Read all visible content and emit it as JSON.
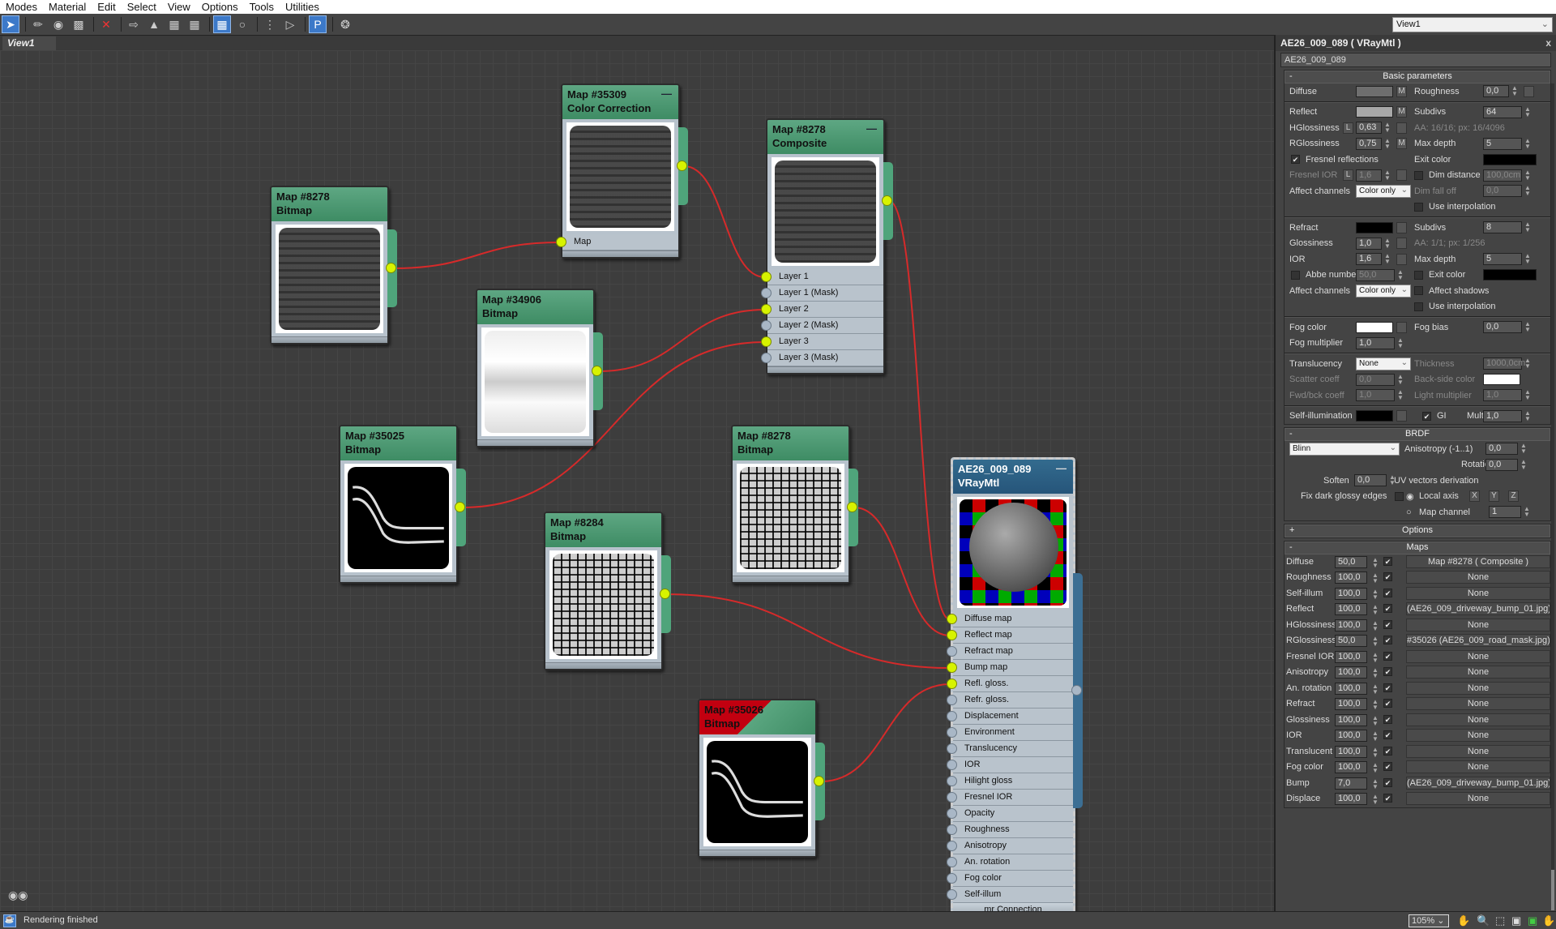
{
  "menu": [
    "Modes",
    "Material",
    "Edit",
    "Select",
    "View",
    "Options",
    "Tools",
    "Utilities"
  ],
  "toolbar": {
    "icons": [
      "select-arrow-icon",
      "eyedropper-icon",
      "put-material-icon",
      "assign-material-icon",
      "delete-icon",
      "move-children-icon",
      "layout-icon",
      "show-map-in-viewport-icon",
      "show-background-icon",
      "background-checker-icon",
      "show-end-result-icon",
      "layout-all-icon",
      "layout-children-icon",
      "parameter-editor-icon",
      "select-by-material-icon"
    ]
  },
  "view_selector": "View1",
  "view_tab": "View1",
  "nodes": [
    {
      "id": "n1",
      "title": "Map #8278",
      "type": "Bitmap",
      "tex": "stone"
    },
    {
      "id": "n2",
      "title": "Map #35309",
      "type": "Color Correction",
      "tex": "stone",
      "slots": [
        {
          "label": "Map",
          "connected": true
        }
      ]
    },
    {
      "id": "n3",
      "title": "Map #8278",
      "type": "Composite",
      "tex": "stone",
      "slots": [
        {
          "label": "Layer 1",
          "connected": true
        },
        {
          "label": "Layer 1 (Mask)",
          "connected": false
        },
        {
          "label": "Layer 2",
          "connected": true
        },
        {
          "label": "Layer 2 (Mask)",
          "connected": false
        },
        {
          "label": "Layer 3",
          "connected": true
        },
        {
          "label": "Layer 3 (Mask)",
          "connected": false
        }
      ]
    },
    {
      "id": "n4",
      "title": "Map #34906",
      "type": "Bitmap",
      "tex": "cloud"
    },
    {
      "id": "n5",
      "title": "Map #35025",
      "type": "Bitmap",
      "tex": "black"
    },
    {
      "id": "n6",
      "title": "Map #8278",
      "type": "Bitmap",
      "tex": "stone2"
    },
    {
      "id": "n7",
      "title": "Map #8284",
      "type": "Bitmap",
      "tex": "stone2"
    },
    {
      "id": "n8",
      "title": "Map #35026",
      "type": "Bitmap",
      "tex": "black",
      "warning": true
    }
  ],
  "material_node": {
    "title": "AE26_009_089",
    "type": "VRayMtl",
    "slots": [
      {
        "label": "Diffuse map",
        "connected": true
      },
      {
        "label": "Reflect map",
        "connected": true
      },
      {
        "label": "Refract map",
        "connected": false
      },
      {
        "label": "Bump map",
        "connected": true
      },
      {
        "label": "Refl. gloss.",
        "connected": true
      },
      {
        "label": "Refr. gloss.",
        "connected": false
      },
      {
        "label": "Displacement",
        "connected": false
      },
      {
        "label": "Environment",
        "connected": false
      },
      {
        "label": "Translucency",
        "connected": false
      },
      {
        "label": "IOR",
        "connected": false
      },
      {
        "label": "Hilight gloss",
        "connected": false
      },
      {
        "label": "Fresnel IOR",
        "connected": false
      },
      {
        "label": "Opacity",
        "connected": false
      },
      {
        "label": "Roughness",
        "connected": false
      },
      {
        "label": "Anisotropy",
        "connected": false
      },
      {
        "label": "An. rotation",
        "connected": false
      },
      {
        "label": "Fog color",
        "connected": false
      },
      {
        "label": "Self-illum",
        "connected": false
      }
    ],
    "footer": "mr Connection"
  },
  "panel": {
    "title": "AE26_009_089  ( VRayMtl )",
    "name": "AE26_009_089",
    "basic": {
      "header": "Basic parameters",
      "diffuse": "Diffuse",
      "roughness_label": "Roughness",
      "roughness": "0,0",
      "reflect": "Reflect",
      "subdivs_label": "Subdivs",
      "subdivs": "64",
      "hgloss_label": "HGlossiness",
      "hgloss": "0,63",
      "aa_info": "AA: 16/16; px: 16/4096",
      "rgloss_label": "RGlossiness",
      "rgloss": "0,75",
      "maxdepth_label": "Max depth",
      "maxdepth": "5",
      "fresnel": "Fresnel reflections",
      "exit_label": "Exit color",
      "fresnel_ior_label": "Fresnel IOR",
      "fresnel_ior": "1,6",
      "dim_dist_label": "Dim distance",
      "dim_dist": "100,0cm",
      "affect_label": "Affect channels",
      "affect": "Color only",
      "dim_falloff_label": "Dim fall off",
      "dim_falloff": "0,0",
      "use_interp": "Use interpolation",
      "refract": "Refract",
      "r_subdivs": "8",
      "glossiness_label": "Glossiness",
      "glossiness": "1,0",
      "r_aa_info": "AA: 1/1; px: 1/256",
      "ior_label": "IOR",
      "ior": "1,6",
      "r_maxdepth": "5",
      "abbe_label": "Abbe number",
      "abbe": "50,0",
      "exit_color_label": "Exit color",
      "r_affect": "Color only",
      "affect_shadows": "Affect shadows",
      "fog_color": "Fog color",
      "fog_bias_label": "Fog bias",
      "fog_bias": "0,0",
      "fog_mult_label": "Fog multiplier",
      "fog_mult": "1,0",
      "transl_label": "Translucency",
      "transl": "None",
      "thickness_label": "Thickness",
      "thickness": "1000,0cm",
      "scatter_label": "Scatter coeff",
      "scatter": "0,0",
      "backside_label": "Back-side color",
      "fwd_label": "Fwd/bck coeff",
      "fwd": "1,0",
      "lightmult_label": "Light multiplier",
      "lightmult": "1,0",
      "selfillum_label": "Self-illumination",
      "gi_label": "GI",
      "mult_label": "Mult",
      "mult": "1,0"
    },
    "brdf": {
      "header": "BRDF",
      "type": "Blinn",
      "aniso_label": "Anisotropy (-1..1)",
      "aniso": "0,0",
      "rotation_label": "Rotation",
      "rotation": "0,0",
      "soften_label": "Soften",
      "soften": "0,0",
      "fix_label": "Fix dark glossy edges",
      "uv_label": "UV vectors derivation",
      "local_axis": "Local axis",
      "x": "X",
      "y": "Y",
      "z": "Z",
      "map_channel_label": "Map channel",
      "map_channel": "1"
    },
    "options_header": "Options",
    "maps_header": "Maps",
    "maps": [
      {
        "label": "Diffuse",
        "amount": "50,0",
        "map": "Map #8278  ( Composite )"
      },
      {
        "label": "Roughness",
        "amount": "100,0",
        "map": "None"
      },
      {
        "label": "Self-illum",
        "amount": "100,0",
        "map": "None"
      },
      {
        "label": "Reflect",
        "amount": "100,0",
        "map": "(AE26_009_driveway_bump_01.jpg)"
      },
      {
        "label": "HGlossiness",
        "amount": "100,0",
        "map": "None"
      },
      {
        "label": "RGlossiness",
        "amount": "50,0",
        "map": "#35026 (AE26_009_road_mask.jpg)"
      },
      {
        "label": "Fresnel IOR",
        "amount": "100,0",
        "map": "None"
      },
      {
        "label": "Anisotropy",
        "amount": "100,0",
        "map": "None"
      },
      {
        "label": "An. rotation",
        "amount": "100,0",
        "map": "None"
      },
      {
        "label": "Refract",
        "amount": "100,0",
        "map": "None"
      },
      {
        "label": "Glossiness",
        "amount": "100,0",
        "map": "None"
      },
      {
        "label": "IOR",
        "amount": "100,0",
        "map": "None"
      },
      {
        "label": "Translucent",
        "amount": "100,0",
        "map": "None"
      },
      {
        "label": "Fog color",
        "amount": "100,0",
        "map": "None"
      },
      {
        "label": "Bump",
        "amount": "7,0",
        "map": "(AE26_009_driveway_bump_01.jpg)"
      },
      {
        "label": "Displace",
        "amount": "100,0",
        "map": "None"
      }
    ]
  },
  "status": {
    "text": "Rendering finished",
    "zoom": "105%"
  }
}
